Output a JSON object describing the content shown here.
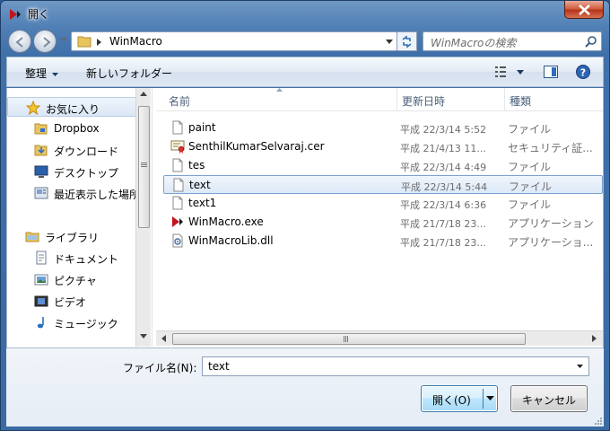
{
  "window": {
    "title": "開く"
  },
  "address": {
    "path": "WinMacro"
  },
  "search": {
    "placeholder": "WinMacroの検索"
  },
  "toolbar": {
    "organize": "整理",
    "new_folder": "新しいフォルダー"
  },
  "nav": {
    "favorites": "お気に入り",
    "items": [
      "Dropbox",
      "ダウンロード",
      "デスクトップ",
      "最近表示した場所"
    ],
    "libraries": "ライブラリ",
    "lib_items": [
      "ドキュメント",
      "ピクチャ",
      "ビデオ",
      "ミュージック"
    ]
  },
  "columns": {
    "name": "名前",
    "date": "更新日時",
    "type": "種類"
  },
  "files": [
    {
      "name": "paint",
      "date": "平成 22/3/14 5:52",
      "type": "ファイル",
      "icon": "blank-file-icon"
    },
    {
      "name": "SenthilKumarSelvaraj.cer",
      "date": "平成 21/4/13 11...",
      "type": "セキュリティ証...",
      "icon": "certificate-icon"
    },
    {
      "name": "tes",
      "date": "平成 22/3/14 4:49",
      "type": "ファイル",
      "icon": "blank-file-icon"
    },
    {
      "name": "text",
      "date": "平成 22/3/14 5:44",
      "type": "ファイル",
      "icon": "blank-file-icon",
      "selected": true
    },
    {
      "name": "text1",
      "date": "平成 22/3/14 6:36",
      "type": "ファイル",
      "icon": "blank-file-icon"
    },
    {
      "name": "WinMacro.exe",
      "date": "平成 21/7/18 23...",
      "type": "アプリケーション",
      "icon": "app-icon"
    },
    {
      "name": "WinMacroLib.dll",
      "date": "平成 21/7/18 23...",
      "type": "アプリケーショ...",
      "icon": "dll-icon"
    }
  ],
  "bottom": {
    "filename_label": "ファイル名(N):",
    "filename_value": "text",
    "open": "開く(O)",
    "cancel": "キャンセル"
  }
}
